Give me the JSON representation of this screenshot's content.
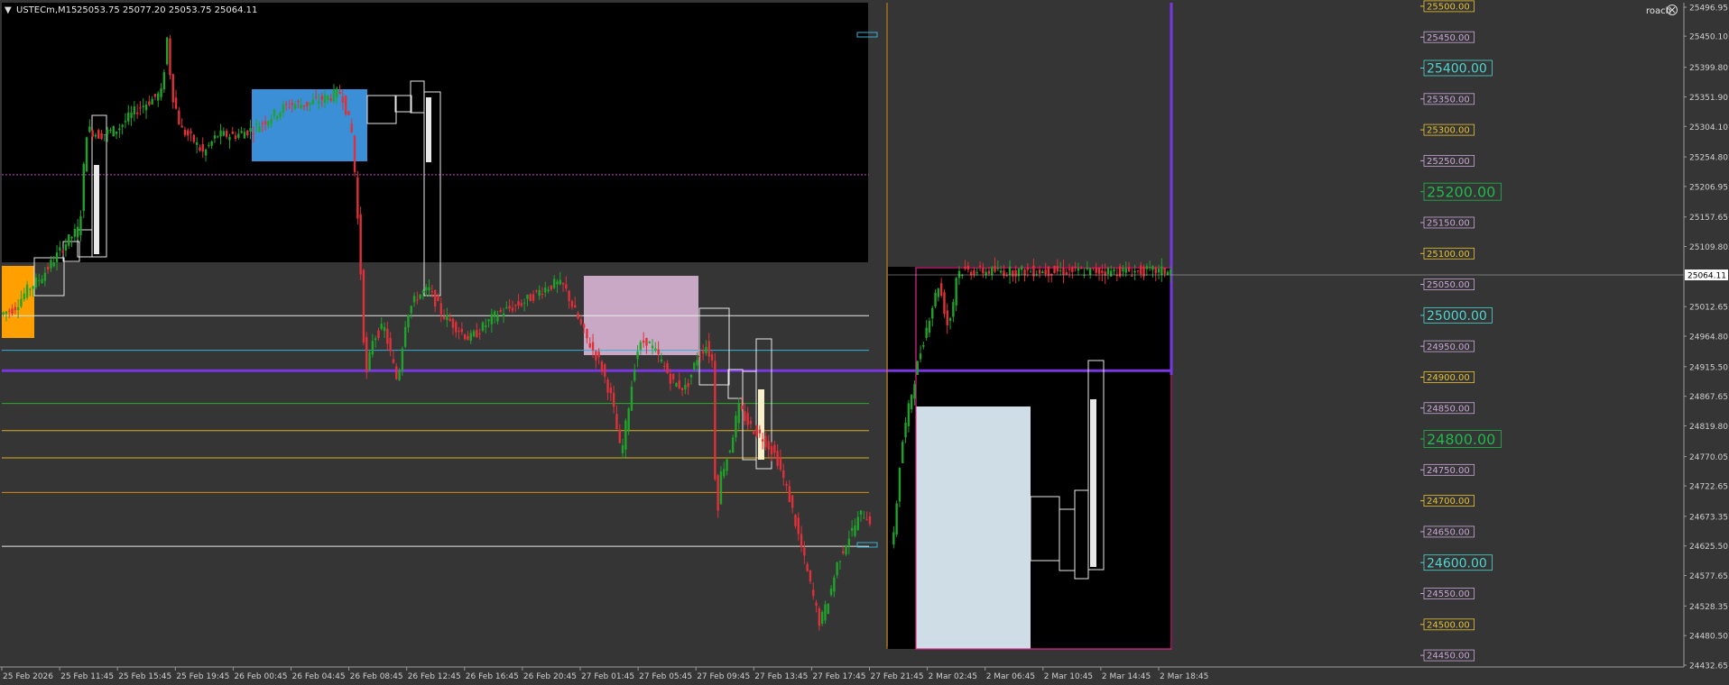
{
  "header": {
    "menu_glyph": "▼",
    "symbol": "USTECm,M15",
    "ohlc": "25053.75 25077.20 25053.75 25064.11",
    "user": "roach",
    "close_icon": "close-circle-icon"
  },
  "colors": {
    "bg": "#353535",
    "black_zone": "#000000",
    "bull": "#1fa32a",
    "bear": "#e0303a",
    "axis_text": "#cfcfcf",
    "purple": "#7a36e0",
    "orange_vline": "#d88a10",
    "blue_box": "#3a8fd6",
    "pink_box": "#c8a8c4",
    "light_box": "#cfdde6",
    "orange_box": "#ffa000",
    "magenta_frame": "#e0288c"
  },
  "right_axis": {
    "current_price": "25064.11",
    "ticks": [
      "25496.95",
      "25450.10",
      "25399.80",
      "25351.90",
      "25304.10",
      "25254.80",
      "25206.95",
      "25157.65",
      "25109.80",
      "25012.65",
      "24964.80",
      "24915.50",
      "24867.65",
      "24819.80",
      "24770.05",
      "24722.65",
      "24673.35",
      "24625.50",
      "24577.65",
      "24528.35",
      "24480.50",
      "24432.65"
    ]
  },
  "price_ladder": [
    {
      "text": "25500.00",
      "kind": "small-yellow"
    },
    {
      "text": "25450.00",
      "kind": "small-purple"
    },
    {
      "text": "25400.00",
      "kind": "big-teal"
    },
    {
      "text": "25350.00",
      "kind": "small-purple"
    },
    {
      "text": "25300.00",
      "kind": "small-yellow"
    },
    {
      "text": "25250.00",
      "kind": "small-purple"
    },
    {
      "text": "25200.00",
      "kind": "big-green"
    },
    {
      "text": "25150.00",
      "kind": "small-purple"
    },
    {
      "text": "25100.00",
      "kind": "small-yellow"
    },
    {
      "text": "25050.00",
      "kind": "small-purple"
    },
    {
      "text": "25000.00",
      "kind": "big-teal"
    },
    {
      "text": "24950.00",
      "kind": "small-purple"
    },
    {
      "text": "24900.00",
      "kind": "small-yellow"
    },
    {
      "text": "24850.00",
      "kind": "small-purple"
    },
    {
      "text": "24800.00",
      "kind": "big-green"
    },
    {
      "text": "24750.00",
      "kind": "small-purple"
    },
    {
      "text": "24700.00",
      "kind": "small-yellow"
    },
    {
      "text": "24650.00",
      "kind": "small-purple"
    },
    {
      "text": "24600.00",
      "kind": "big-teal"
    },
    {
      "text": "24550.00",
      "kind": "small-purple"
    },
    {
      "text": "24500.00",
      "kind": "small-yellow"
    },
    {
      "text": "24450.00",
      "kind": "small-purple"
    }
  ],
  "time_axis": [
    "25 Feb 2026",
    "25 Feb 11:45",
    "25 Feb 15:45",
    "25 Feb 19:45",
    "26 Feb 00:45",
    "26 Feb 04:45",
    "26 Feb 08:45",
    "26 Feb 12:45",
    "26 Feb 16:45",
    "26 Feb 20:45",
    "27 Feb 01:45",
    "27 Feb 05:45",
    "27 Feb 09:45",
    "27 Feb 13:45",
    "27 Feb 17:45",
    "27 Feb 21:45",
    "2 Mar 02:45",
    "2 Mar 06:45",
    "2 Mar 10:45",
    "2 Mar 14:45",
    "2 Mar 18:45"
  ],
  "chart_data": {
    "type": "candlestick",
    "symbol": "USTECm",
    "timeframe": "M15",
    "ylim": [
      24410,
      25520
    ],
    "last_price": 25064.11,
    "horizontal_levels": [
      {
        "price": 25226,
        "style": "dotted",
        "color": "#c040c0"
      },
      {
        "price": 24998,
        "color": "#e8e8e8"
      },
      {
        "price": 24942,
        "color": "#38b0d8"
      },
      {
        "price": 24909,
        "color": "#7a36e0",
        "width": 3
      },
      {
        "price": 24856,
        "color": "#28b028"
      },
      {
        "price": 24812,
        "color": "#d8b020"
      },
      {
        "price": 24768,
        "color": "#d8b020"
      },
      {
        "price": 24712,
        "color": "#d88a10"
      },
      {
        "price": 24625,
        "color": "#e8e8e8"
      }
    ],
    "path": [
      [
        0,
        25000
      ],
      [
        15,
        25010
      ],
      [
        30,
        25040
      ],
      [
        45,
        25060
      ],
      [
        60,
        25090
      ],
      [
        75,
        25120
      ],
      [
        88,
        25140
      ],
      [
        92,
        25230
      ],
      [
        96,
        25300
      ],
      [
        110,
        25290
      ],
      [
        130,
        25300
      ],
      [
        150,
        25330
      ],
      [
        170,
        25350
      ],
      [
        180,
        25360
      ],
      [
        184,
        25460
      ],
      [
        190,
        25360
      ],
      [
        200,
        25300
      ],
      [
        215,
        25280
      ],
      [
        225,
        25260
      ],
      [
        240,
        25290
      ],
      [
        260,
        25290
      ],
      [
        280,
        25300
      ],
      [
        300,
        25320
      ],
      [
        320,
        25340
      ],
      [
        340,
        25340
      ],
      [
        360,
        25350
      ],
      [
        378,
        25360
      ],
      [
        385,
        25320
      ],
      [
        390,
        25290
      ],
      [
        395,
        25180
      ],
      [
        400,
        25050
      ],
      [
        403,
        24950
      ],
      [
        406,
        24900
      ],
      [
        412,
        24960
      ],
      [
        425,
        24980
      ],
      [
        440,
        24890
      ],
      [
        450,
        25000
      ],
      [
        462,
        25030
      ],
      [
        475,
        25040
      ],
      [
        490,
        25000
      ],
      [
        505,
        24980
      ],
      [
        520,
        24960
      ],
      [
        535,
        24980
      ],
      [
        550,
        25000
      ],
      [
        565,
        25010
      ],
      [
        580,
        25020
      ],
      [
        600,
        25040
      ],
      [
        615,
        25050
      ],
      [
        625,
        25045
      ],
      [
        635,
        25010
      ],
      [
        650,
        24960
      ],
      [
        665,
        24920
      ],
      [
        678,
        24860
      ],
      [
        688,
        24770
      ],
      [
        695,
        24840
      ],
      [
        705,
        24940
      ],
      [
        715,
        24960
      ],
      [
        730,
        24930
      ],
      [
        745,
        24890
      ],
      [
        760,
        24880
      ],
      [
        772,
        24930
      ],
      [
        782,
        24950
      ],
      [
        790,
        24920
      ],
      [
        793,
        24650
      ],
      [
        798,
        24740
      ],
      [
        808,
        24780
      ],
      [
        818,
        24850
      ],
      [
        830,
        24820
      ],
      [
        845,
        24800
      ],
      [
        860,
        24770
      ],
      [
        875,
        24700
      ],
      [
        888,
        24620
      ],
      [
        898,
        24560
      ],
      [
        908,
        24500
      ],
      [
        918,
        24540
      ],
      [
        928,
        24600
      ],
      [
        940,
        24640
      ],
      [
        955,
        24680
      ],
      [
        968,
        24660
      ],
      [
        980,
        24620
      ],
      [
        990,
        24640
      ],
      [
        998,
        24780
      ],
      [
        1008,
        24860
      ],
      [
        1018,
        24930
      ],
      [
        1030,
        25000
      ],
      [
        1040,
        25050
      ],
      [
        1050,
        24980
      ],
      [
        1055,
        25010
      ],
      [
        1060,
        25070
      ]
    ]
  }
}
